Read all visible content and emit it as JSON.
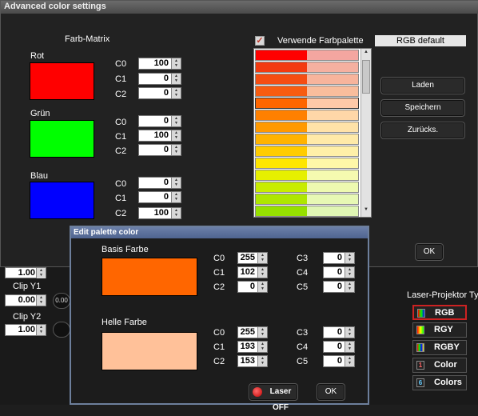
{
  "window": {
    "title": "Advanced color settings"
  },
  "matrix": {
    "title": "Farb-Matrix",
    "groups": [
      {
        "name": "Rot",
        "color": "#ff0000",
        "values": [
          "100",
          "0",
          "0"
        ]
      },
      {
        "name": "Grün",
        "color": "#00ff00",
        "values": [
          "0",
          "100",
          "0"
        ]
      },
      {
        "name": "Blau",
        "color": "#0000ff",
        "values": [
          "0",
          "0",
          "100"
        ]
      }
    ],
    "channel_labels": [
      "C0",
      "C1",
      "C2"
    ]
  },
  "palette": {
    "use_label": "Verwende Farbpalette",
    "use_checked": true,
    "preset": "RGB default",
    "rows": [
      [
        "#ff0000",
        "#f4a6a0"
      ],
      [
        "#f33a10",
        "#f5b0a0"
      ],
      [
        "#f54d12",
        "#f7b49c"
      ],
      [
        "#f75c10",
        "#f9bd9c"
      ],
      [
        "#ff6600",
        "#ffc9a8"
      ],
      [
        "#ff8000",
        "#ffd7a8"
      ],
      [
        "#ff9900",
        "#ffe2a8"
      ],
      [
        "#ffb300",
        "#ffeaa8"
      ],
      [
        "#ffcc00",
        "#fff0a8"
      ],
      [
        "#ffe600",
        "#fff7a8"
      ],
      [
        "#e6f000",
        "#f5fab0"
      ],
      [
        "#c8ec00",
        "#eef9b0"
      ],
      [
        "#aee600",
        "#e7f8b4"
      ],
      [
        "#96e000",
        "#e0f6b4"
      ]
    ]
  },
  "buttons": {
    "load": "Laden",
    "save": "Speichern",
    "reset": "Zurücks.",
    "ok": "OK"
  },
  "background": {
    "clip_y1": "Clip Y1",
    "clip_y2": "Clip Y2",
    "val_top": "1.00",
    "val_y1": "0.00",
    "val_y2": "1.00",
    "small_val": "0.00"
  },
  "dialog": {
    "title": "Edit palette color",
    "base_label": "Basis Farbe",
    "base_color": "#ff6600",
    "base_values": [
      "255",
      "102",
      "0"
    ],
    "base_extra": [
      "0",
      "0",
      "0"
    ],
    "light_label": "Helle Farbe",
    "light_color": "#ffc199",
    "light_values": [
      "255",
      "193",
      "153"
    ],
    "light_extra": [
      "0",
      "0",
      "0"
    ],
    "labels_left": [
      "C0",
      "C1",
      "C2"
    ],
    "labels_right": [
      "C3",
      "C4",
      "C5"
    ],
    "laser_label": "Laser OFF",
    "ok_label": "OK"
  },
  "projector": {
    "title": "Laser-Projektor Ty",
    "options": [
      {
        "label": "RGB",
        "selected": true
      },
      {
        "label": "RGY",
        "selected": false
      },
      {
        "label": "RGBY",
        "selected": false
      },
      {
        "label": "Color",
        "selected": false,
        "num": "1"
      },
      {
        "label": "Colors",
        "selected": false,
        "num": "6"
      }
    ]
  }
}
